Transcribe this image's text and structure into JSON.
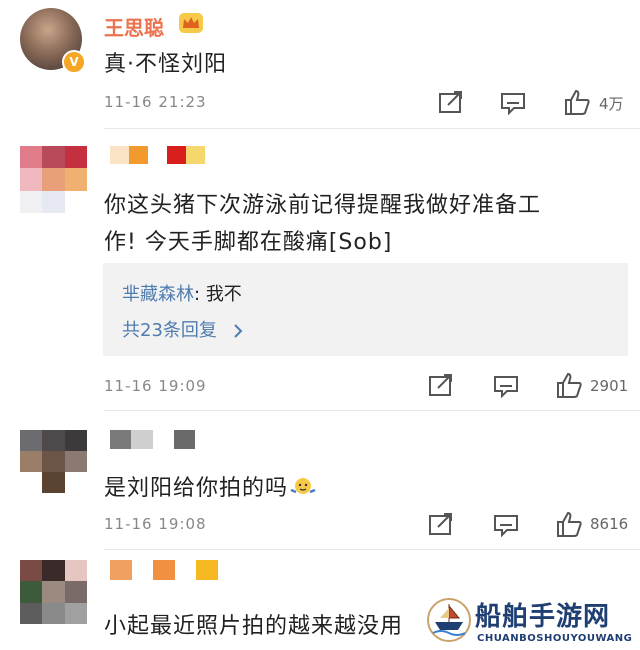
{
  "post": {
    "username": "王思聪",
    "badge": "V",
    "text": "真·不怪刘阳",
    "time": "11-16 21:23",
    "likes": "4万"
  },
  "comments": [
    {
      "text_line1": "你这头猪下次游泳前记得提醒我做好准备工",
      "text_line2": "作! 今天手脚都在酸痛[Sob]",
      "reply_name": "芈藏森林",
      "reply_sep": ":",
      "reply_text": "我不",
      "reply_more": "共23条回复",
      "time": "11-16 19:09",
      "likes": "2901"
    },
    {
      "text": "是刘阳给你拍的吗",
      "time": "11-16 19:08",
      "likes": "8616"
    },
    {
      "text": "小起最近照片拍的越来越没用"
    }
  ],
  "watermark": {
    "title": "船舶手游网",
    "subtitle": "CHUANBOSHOUYOUWANG"
  },
  "colors": {
    "username": "#eb7350",
    "link": "#507daf",
    "reply_bg": "#f2f2f2"
  }
}
